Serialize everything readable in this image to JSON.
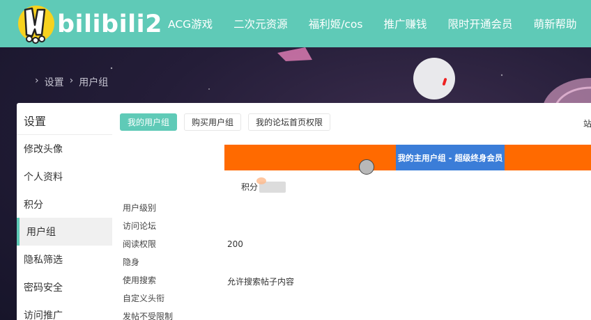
{
  "header": {
    "logo_text": "bilibili2",
    "nav": [
      "ACG游戏",
      "二次元资源",
      "福利姬/cos",
      "推广赚钱",
      "限时开通会员",
      "萌新帮助"
    ]
  },
  "breadcrumb": {
    "sep": "›",
    "items": [
      "设置",
      "用户组"
    ]
  },
  "sidebar": {
    "title": "设置",
    "items": [
      "修改头像",
      "个人资料",
      "积分",
      "用户组",
      "隐私筛选",
      "密码安全",
      "访问推广"
    ]
  },
  "tabs": [
    "我的用户组",
    "购买用户组",
    "我的论坛首页权限"
  ],
  "site_fragment": "站",
  "banner": {
    "text": "我的主用户组 - 超级终身会员"
  },
  "points_label": "积分",
  "permission_labels": [
    "用户级别",
    "访问论坛",
    "阅读权限",
    "隐身",
    "使用搜索",
    "自定义头衔",
    "发帖不受限制"
  ],
  "values": {
    "read_permission": "200",
    "search": "允许搜索帖子内容"
  },
  "colors": {
    "header": "#5fcab7",
    "banner_orange": "#ff6a00",
    "banner_blue": "#3b7dd8"
  }
}
